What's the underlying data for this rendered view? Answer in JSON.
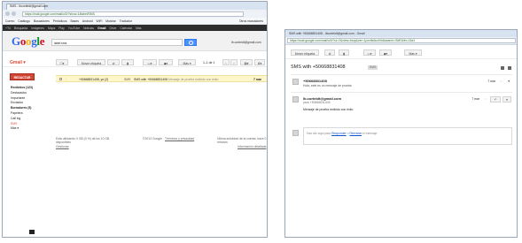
{
  "left_window": {
    "tab_title": "SMS - lbcorteldt@gmail.com",
    "url": "https://mail.google.com/mail/u/0/?shva=1#label/SMS",
    "bookmarks": [
      "Correo",
      "Catálogo",
      "Buscadores",
      "Periódicos",
      "Bases",
      "Android",
      "WiFi",
      "Mostrar",
      "Traductor",
      "Otros marcadores"
    ],
    "topbar": [
      "+Tú",
      "Búsqueda",
      "Imágenes",
      "Maps",
      "Play",
      "YouTube",
      "Noticias",
      "Gmail",
      "Drive",
      "Calendar",
      "Más"
    ],
    "topbar_active": "Gmail",
    "logo": "Google",
    "search_value": "label:sms",
    "user": "lb.corteldt@gmail.com",
    "gmail_label": "Gmail ▾",
    "toolbar": {
      "more_label": "Más ▾",
      "pager": "1–1 de 1",
      "archive": "Mover etiqueta"
    },
    "compose": "REDACTAR",
    "nav": [
      {
        "label": "Recibidos (123)",
        "bold": true,
        "red": false
      },
      {
        "label": "Destacados",
        "bold": false,
        "red": false
      },
      {
        "label": "Importante",
        "bold": false,
        "red": false
      },
      {
        "label": "Enviados",
        "bold": false,
        "red": false
      },
      {
        "label": "Borradores (5)",
        "bold": true,
        "red": false
      },
      {
        "label": "Papelera",
        "bold": false,
        "red": false
      },
      {
        "label": "Call log",
        "bold": false,
        "red": false
      },
      {
        "label": "SMS",
        "bold": false,
        "red": true
      },
      {
        "label": "Más ▾",
        "bold": false,
        "red": false
      }
    ],
    "message": {
      "sender": "+50668831408, yo (2)",
      "label": "SMS",
      "subject": "SMS with +50668831408",
      "snippet": "Mensaje de prueba recibido con éxito",
      "time": "7 mar"
    },
    "footer": {
      "storage": "Está utilizando 0 GB (0 %) de los 10 GB disponibles",
      "manage": "Gestionar",
      "copyright": "©2013 Google",
      "terms": "Términos y privacidad",
      "activity": "Última actividad de la cuenta: hace 0 minutos",
      "details": "Información detallada"
    }
  },
  "right_window": {
    "title": "SMS with +50668831408 - lbcorteldt@gmail.com - Gmail",
    "url": "https://mail.google.com/mail/u/0/?ui=2&view=btop&ver=1pxvtfa3uvf4h&search=SMS&th=13d4",
    "toolbar": {
      "archive": "Mover etiqueta",
      "more": "Más ▾"
    },
    "subject": "SMS with +50668831408",
    "label_chip": "SMS",
    "messages": [
      {
        "sender": "+50668831408",
        "body": "Hola, este es un mensaje de prueba",
        "time": "7 mar"
      },
      {
        "sender": "lb.corteldt@gmail.com",
        "to": "para +50668831408",
        "body": "Mensaje de prueba recibido con éxito",
        "time": "7 mar"
      }
    ],
    "reply": {
      "prefix": "Haz clic aquí",
      "text": " para ",
      "reply_link": "Responder",
      "or": " o ",
      "forward_link": "Reenviar",
      "suffix": " el mensaje"
    }
  }
}
